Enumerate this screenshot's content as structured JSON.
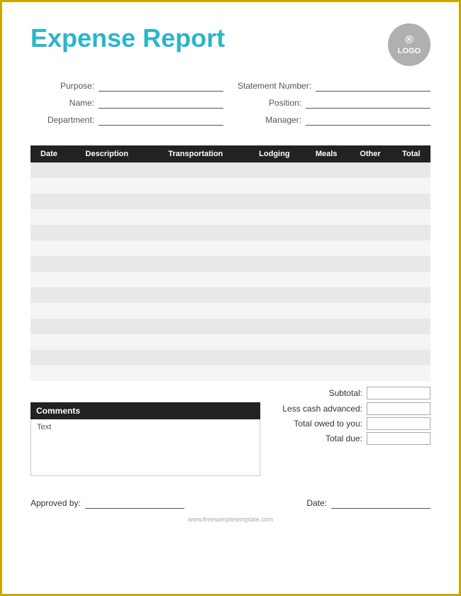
{
  "header": {
    "title": "Expense Report",
    "logo_r": "®",
    "logo_text": "LOGO"
  },
  "form": {
    "left": [
      {
        "label": "Purpose:",
        "value": ""
      },
      {
        "label": "Name:",
        "value": ""
      },
      {
        "label": "Department:",
        "value": ""
      }
    ],
    "right": [
      {
        "label": "Statement Number:",
        "value": ""
      },
      {
        "label": "Position:",
        "value": ""
      },
      {
        "label": "Manager:",
        "value": ""
      }
    ]
  },
  "table": {
    "headers": [
      "Date",
      "Description",
      "Transportation",
      "Lodging",
      "Meals",
      "Other",
      "Total"
    ],
    "rows": 14
  },
  "subtotal": {
    "label": "Subtotal:",
    "value": ""
  },
  "comments": {
    "header": "Comments",
    "placeholder": "Text"
  },
  "totals": [
    {
      "label": "Less cash advanced:",
      "value": ""
    },
    {
      "label": "Total owed to you:",
      "value": ""
    },
    {
      "label": "Total due:",
      "value": ""
    }
  ],
  "approval": {
    "approved_label": "Approved by:",
    "date_label": "Date:"
  },
  "watermark": "www.freesampletemplate.com"
}
